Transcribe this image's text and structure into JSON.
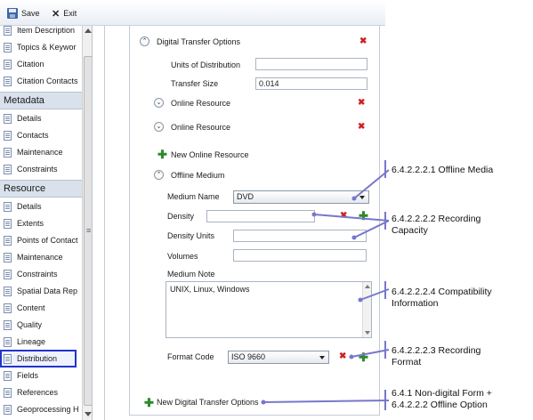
{
  "toolbar": {
    "save_label": "Save",
    "exit_label": "Exit"
  },
  "sidebar": {
    "top_items": [
      "Item Description",
      "Topics & Keywor",
      "Citation",
      "Citation Contacts"
    ],
    "metadata_header": "Metadata",
    "metadata_items": [
      "Details",
      "Contacts",
      "Maintenance",
      "Constraints"
    ],
    "resource_header": "Resource",
    "resource_items": [
      "Details",
      "Extents",
      "Points of Contact",
      "Maintenance",
      "Constraints",
      "Spatial Data Rep",
      "Content",
      "Quality",
      "Lineage",
      "Distribution",
      "Fields",
      "References",
      "Geoprocessing H"
    ],
    "selected": "Distribution",
    "grip": "≡"
  },
  "form": {
    "digital_transfer_title": "Digital Transfer Options",
    "units_label": "Units of Distribution",
    "units_value": "",
    "transfer_size_label": "Transfer Size",
    "transfer_size_value": "0.014",
    "online_resource_1": "Online Resource",
    "online_resource_2": "Online Resource",
    "new_online_resource": "New Online Resource",
    "offline_medium": "Offline Medium",
    "medium_name_label": "Medium Name",
    "medium_name_value": "DVD",
    "density_label": "Density",
    "density_value": "",
    "density_units_label": "Density Units",
    "density_units_value": "",
    "volumes_label": "Volumes",
    "volumes_value": "",
    "medium_note_label": "Medium Note",
    "medium_note_value": "UNIX, Linux, Windows",
    "format_code_label": "Format Code",
    "format_code_value": "ISO 9660",
    "new_digital_transfer": "New Digital Transfer Options"
  },
  "annotations": {
    "offline_media": "6.4.2.2.2.1 Offline Media",
    "recording_capacity_1": "6.4.2.2.2.2 Recording",
    "recording_capacity_2": "Capacity",
    "compatibility_1": "6.4.2.2.2.4 Compatibility",
    "compatibility_2": "Information",
    "recording_format_1": "6.4.2.2.2.3 Recording",
    "recording_format_2": "Format",
    "non_digital_1": "6.4.1 Non-digital Form +",
    "non_digital_2": "6.4.2.2.2 Offline Option"
  },
  "colors": {
    "annotation_line": "#7777cc",
    "selection": "#2233cc",
    "delete": "#cc2222",
    "add": "#2d8a2d"
  },
  "icons": {
    "save": "floppy-icon",
    "exit": "close-icon",
    "doc": "document-icon",
    "collapse": "chevron-up-icon",
    "expand": "chevron-down-icon",
    "delete": "delete-icon",
    "add": "plus-icon"
  }
}
